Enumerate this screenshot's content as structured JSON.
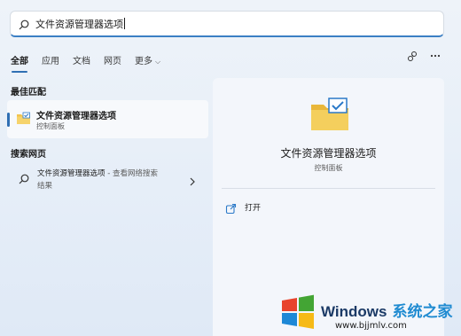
{
  "search": {
    "query": "文件资源管理器选项"
  },
  "tabs": [
    {
      "label": "全部",
      "active": true
    },
    {
      "label": "应用"
    },
    {
      "label": "文档"
    },
    {
      "label": "网页"
    },
    {
      "label": "更多",
      "has_dropdown": true
    }
  ],
  "top_icons": [
    "share-feedback-icon",
    "more-options-icon"
  ],
  "best_match": {
    "section_title": "最佳匹配",
    "title": "文件资源管理器选项",
    "subtitle": "控制面板",
    "icon": "folder-check-icon"
  },
  "web_search": {
    "section_title": "搜索网页",
    "item_title": "文件资源管理器选项",
    "item_suffix": " - 查看网络搜索",
    "item_line2": "结果"
  },
  "details": {
    "title": "文件资源管理器选项",
    "subtitle": "控制面板",
    "open_label": "打开"
  },
  "watermark": {
    "brand": "Windows",
    "brand_cn": "系统之家",
    "url": "www.bjjmlv.com"
  },
  "colors": {
    "accent": "#2f6fb3",
    "folder_yellow": "#f2c44e",
    "check_blue": "#2b79c8"
  }
}
